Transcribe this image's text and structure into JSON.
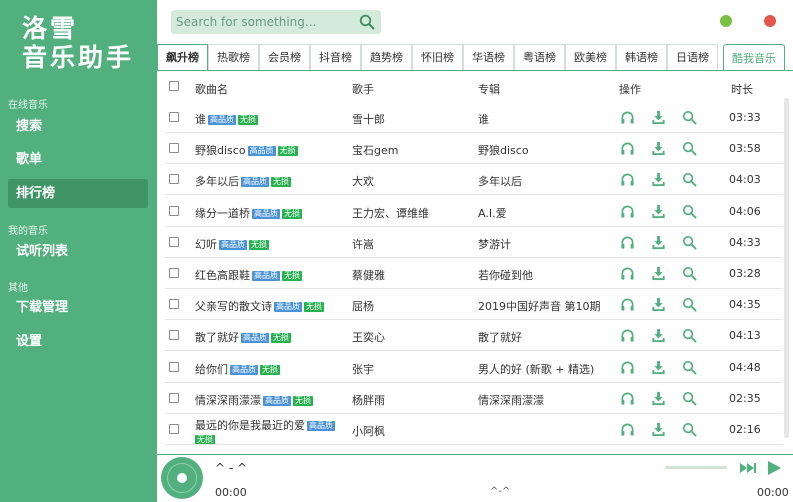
{
  "app": {
    "logo_line1": "洛雪",
    "logo_line2": "音乐助手"
  },
  "sidebar": {
    "groups": [
      {
        "label": "在线音乐"
      },
      {
        "label": "我的音乐"
      },
      {
        "label": "其他"
      }
    ],
    "items": [
      {
        "label": "搜索"
      },
      {
        "label": "歌单"
      },
      {
        "label": "排行榜",
        "active": true
      },
      {
        "label": "试听列表"
      },
      {
        "label": "下载管理"
      },
      {
        "label": "设置"
      }
    ]
  },
  "search": {
    "placeholder": "Search for something..."
  },
  "colors": {
    "accent": "#51b07e",
    "minimize": "#7bc043",
    "close": "#e2574c",
    "badge_hq": "#4b93d6",
    "badge_nl": "#27b150"
  },
  "tabs": [
    {
      "label": "飙升榜",
      "active": true
    },
    {
      "label": "热歌榜"
    },
    {
      "label": "会员榜"
    },
    {
      "label": "抖音榜"
    },
    {
      "label": "趋势榜"
    },
    {
      "label": "怀旧榜"
    },
    {
      "label": "华语榜"
    },
    {
      "label": "粤语榜"
    },
    {
      "label": "欧美榜"
    },
    {
      "label": "韩语榜"
    },
    {
      "label": "日语榜"
    }
  ],
  "source_tab": {
    "label": "酷我音乐"
  },
  "table": {
    "headers": {
      "name": "歌曲名",
      "artist": "歌手",
      "album": "专辑",
      "actions": "操作",
      "duration": "时长"
    },
    "badges": {
      "hq": "高品质",
      "nl": "无损"
    },
    "rows": [
      {
        "name": "谁",
        "artist": "雪十郎",
        "album": "谁",
        "duration": "03:33"
      },
      {
        "name": "野狼disco",
        "artist": "宝石gem",
        "album": "野狼disco",
        "duration": "03:58"
      },
      {
        "name": "多年以后",
        "artist": "大欢",
        "album": "多年以后",
        "duration": "04:03"
      },
      {
        "name": "缘分一道桥",
        "artist": "王力宏、谭维维",
        "album": "A.I.爱",
        "duration": "04:06"
      },
      {
        "name": "幻听",
        "artist": "许嵩",
        "album": "梦游计",
        "duration": "04:33"
      },
      {
        "name": "红色高跟鞋",
        "artist": "蔡健雅",
        "album": "若你碰到他",
        "duration": "03:28"
      },
      {
        "name": "父亲写的散文诗",
        "artist": "屈杨",
        "album": "2019中国好声音 第10期",
        "duration": "04:35"
      },
      {
        "name": "散了就好",
        "artist": "王奕心",
        "album": "散了就好",
        "duration": "04:13"
      },
      {
        "name": "给你们",
        "artist": "张宇",
        "album": "男人的好 (新歌 + 精选)",
        "duration": "04:48"
      },
      {
        "name": "情深深雨濛濛",
        "artist": "杨胖雨",
        "album": "情深深雨濛濛",
        "duration": "02:35"
      },
      {
        "name": "最远的你是我最近的爱",
        "artist": "小阿枫",
        "album": "",
        "duration": "02:16"
      }
    ]
  },
  "player": {
    "title": "^ - ^",
    "current_time": "00:00",
    "status": "^-^",
    "total_time": "00:00"
  }
}
